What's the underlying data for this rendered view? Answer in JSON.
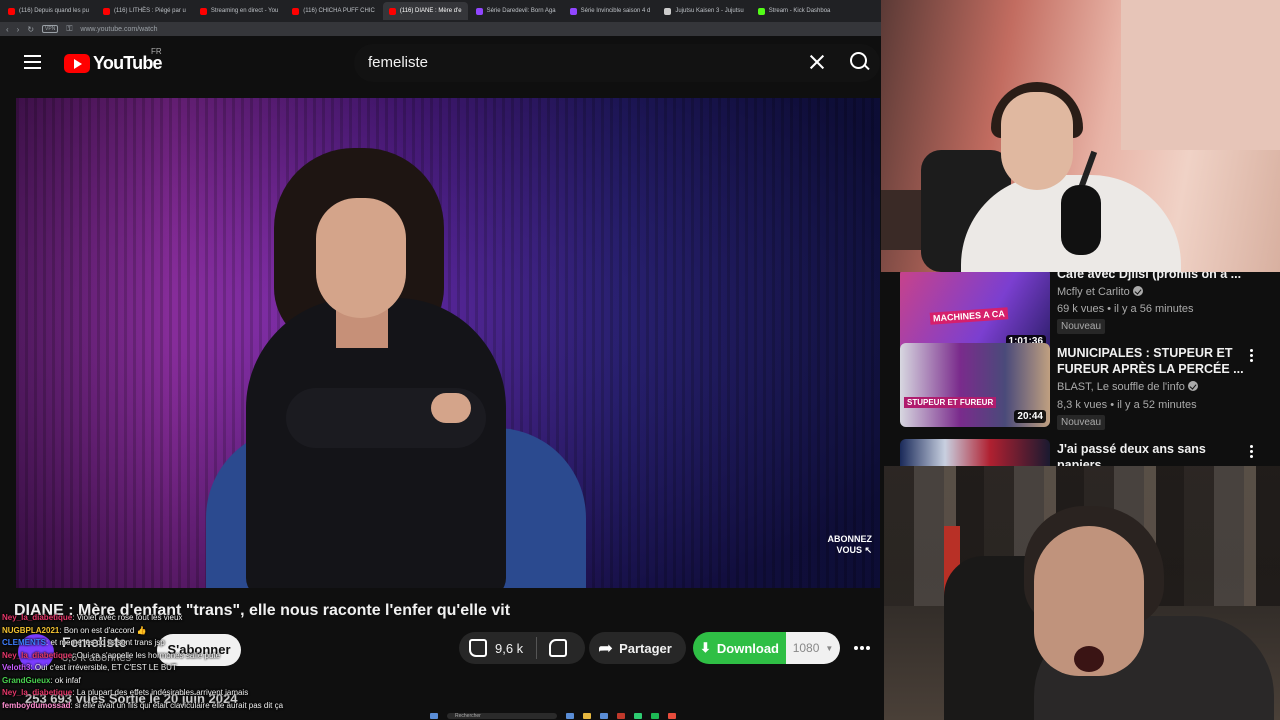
{
  "browser": {
    "tabs": [
      {
        "label": "(116) Depuis quand les pu",
        "fav": "red"
      },
      {
        "label": "(116) LITHÈS : Piégé par u",
        "fav": "red"
      },
      {
        "label": "Streaming en direct - You",
        "fav": "red"
      },
      {
        "label": "(116) CHICHA PUFF CHIC",
        "fav": "red"
      },
      {
        "label": "(116) DIANE : Mère d'e",
        "fav": "red",
        "active": true
      },
      {
        "label": "Série Daredevil: Born Aga",
        "fav": "purple"
      },
      {
        "label": "Série Invincible saison 4 d",
        "fav": "purple"
      },
      {
        "label": "Jujutsu Kaisen 3 - Jujutsu",
        "fav": "dark"
      },
      {
        "label": "Stream - Kick Dashboa",
        "fav": "green"
      }
    ],
    "vpn_label": "VPN",
    "url": "www.youtube.com/watch"
  },
  "header": {
    "logo_text": "YouTube",
    "country": "FR",
    "search_value": "femeliste"
  },
  "video": {
    "overlay_line1": "ABONNEZ",
    "overlay_line2": "VOUS ↖",
    "title": "DIANE : Mère d'enfant \"trans\", elle nous raconte l'enfer qu'elle vit",
    "channel": "Femeliste",
    "subscribers": "8,6 k abonnés",
    "subscribe_label": "S'abonner",
    "likes": "9,6 k",
    "share_label": "Partager",
    "download_label": "Download",
    "quality": "1080",
    "views_date": "253 693 vues  Sortie le 20 juin 2024"
  },
  "related": [
    {
      "title": "Café avec Djilsi (promis on a ...",
      "channel": "Mcfly et Carlito",
      "meta": "69 k vues • il y a 56 minutes",
      "badge": "Nouveau",
      "duration": "1:01:36",
      "thumb_text": "MACHINES A CA"
    },
    {
      "title": "MUNICIPALES : STUPEUR ET FUREUR APRÈS LA PERCÉE ...",
      "channel": "BLAST, Le souffle de l'info",
      "meta": "8,3 k vues • il y a 52 minutes",
      "badge": "Nouveau",
      "duration": "20:44",
      "thumb_text": "STUPEUR ET FUREUR"
    },
    {
      "title": "J'ai passé deux ans sans papiers",
      "channel": "",
      "meta": "",
      "badge": "",
      "duration": "",
      "thumb_text": ""
    }
  ],
  "chat": [
    {
      "user": "Ney_la_diabetique",
      "color": "#e6376a",
      "msg": "Violet avec rose tout les vieux"
    },
    {
      "user": "NUGBPLA2021",
      "color": "#f2c230",
      "msg": "Bon on est d'accord 👍"
    },
    {
      "user": "CLEMENTS",
      "color": "#3f7fff",
      "msg": "et meme les pd ils sont trans jsp"
    },
    {
      "user": "Ney_la_diabetique",
      "color": "#e6376a",
      "msg": "Oui ça s'appelle les hormones salle pute"
    },
    {
      "user": "Veloth3",
      "color": "#c85cff",
      "msg": "Oui c'est irréversible, ET C'EST LE BUT"
    },
    {
      "user": "GrandGueux",
      "color": "#49d14f",
      "msg": "ok infaf"
    },
    {
      "user": "Ney_la_diabetique",
      "color": "#e6376a",
      "msg": "La plupart des effets indésirables arrivent jamais"
    },
    {
      "user": "femboydumossad",
      "color": "#ff8fd1",
      "msg": "si elle avait un fils qui était claviculaire elle aurait pas dit ça"
    }
  ],
  "taskbar": {
    "search_label": "Rechercher"
  }
}
